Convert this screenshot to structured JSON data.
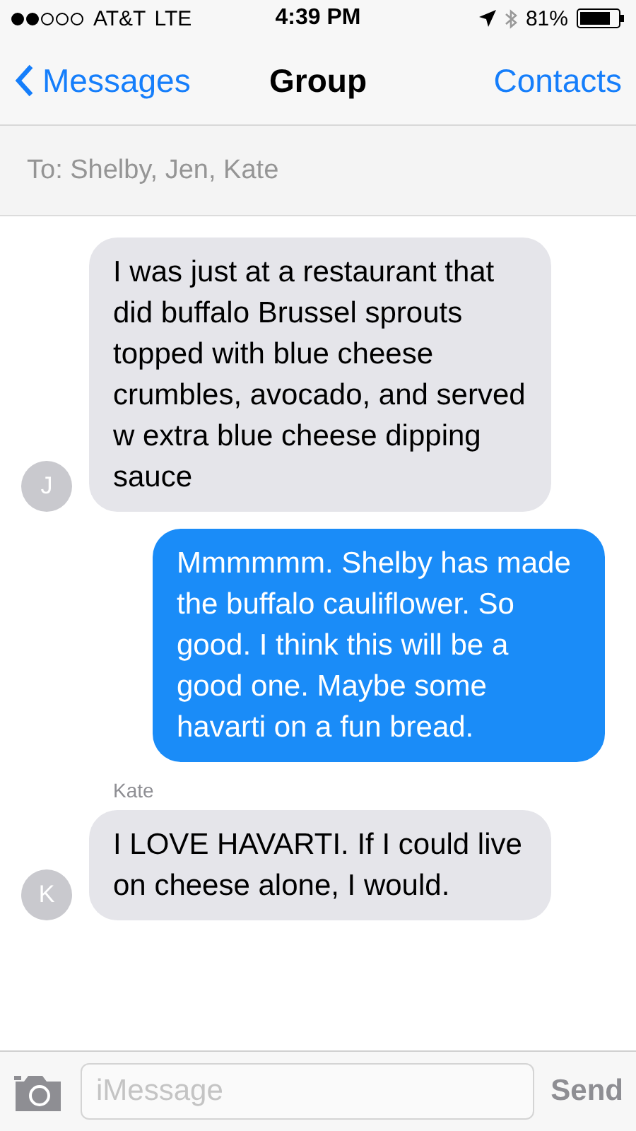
{
  "status_bar": {
    "carrier": "AT&T",
    "network": "LTE",
    "time": "4:39 PM",
    "battery": "81%"
  },
  "nav": {
    "back": "Messages",
    "title": "Group",
    "action": "Contacts"
  },
  "recipients": "To: Shelby, Jen, Kate",
  "messages": [
    {
      "kind": "incoming",
      "avatar": "J",
      "text": "I was just at a restaurant that did buffalo Brussel sprouts topped with blue cheese crumbles, avocado, and served w extra blue cheese dipping sauce"
    },
    {
      "kind": "outgoing",
      "text": "Mmmmmm.  Shelby has made the buffalo cauliflower.  So good. I think this will be a good one.  Maybe some havarti on a fun bread."
    },
    {
      "kind": "incoming",
      "sender": "Kate",
      "avatar": "K",
      "text": "I LOVE HAVARTI. If I could live on cheese alone, I would."
    }
  ],
  "composer": {
    "placeholder": "iMessage",
    "send": "Send"
  }
}
